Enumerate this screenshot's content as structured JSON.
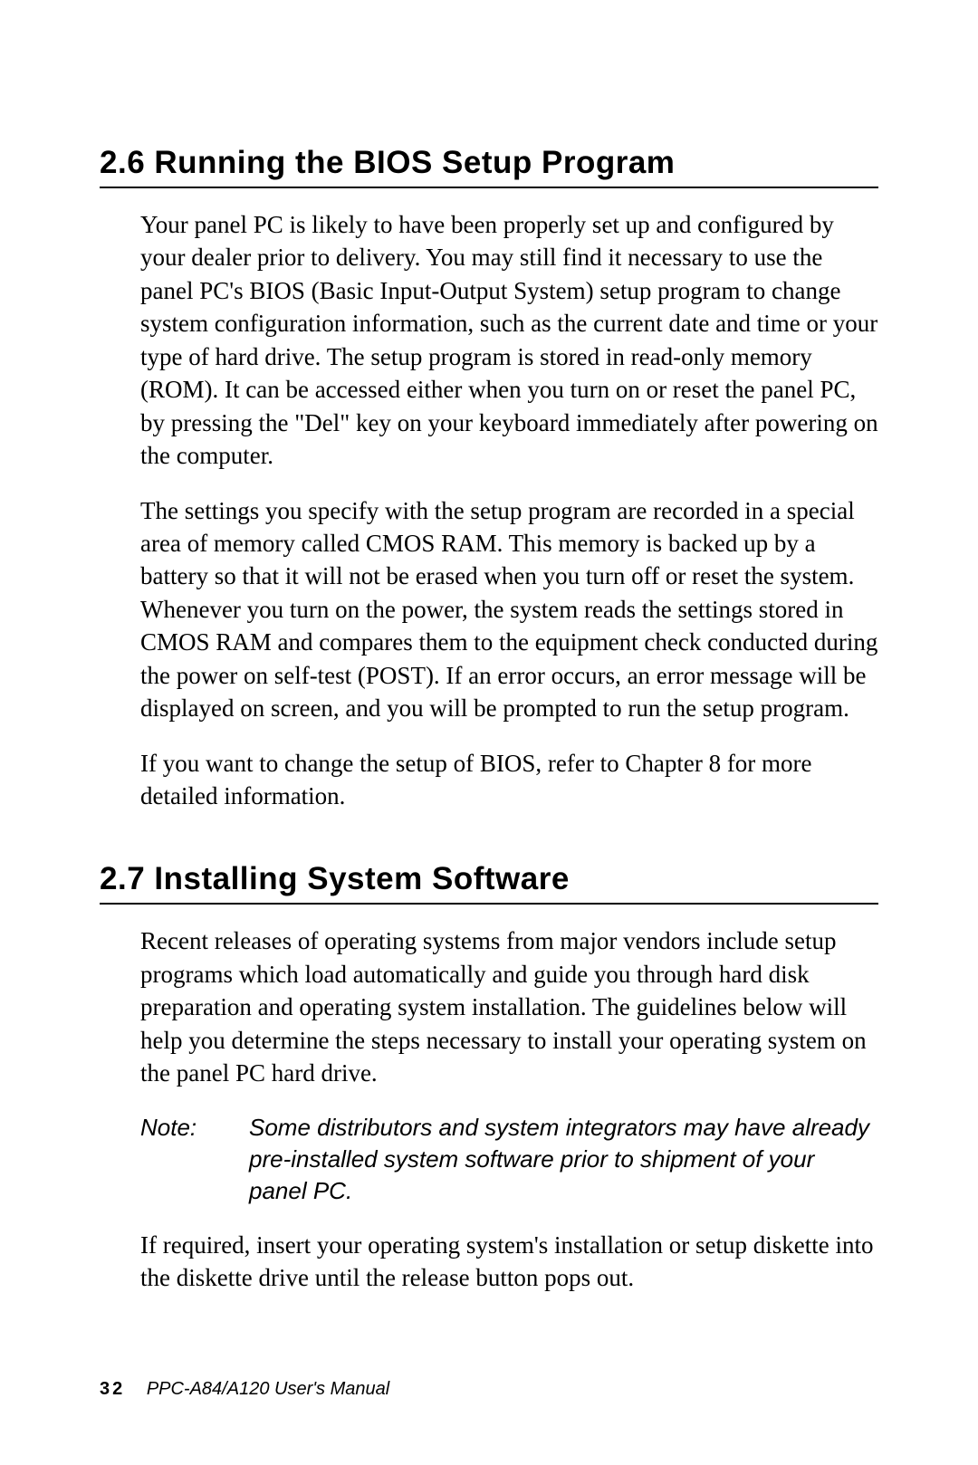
{
  "sections": [
    {
      "number": "2.6",
      "title": "Running the BIOS Setup Program",
      "paragraphs": [
        "Your panel PC is likely to have been properly set up and configured by your dealer prior to delivery. You may still find it necessary to use the panel PC's BIOS (Basic Input-Output System) setup program to change system configuration information, such as the current date and time or your type of hard drive. The setup program is stored in read-only memory (ROM). It can be accessed either when you turn on or reset the panel PC, by pressing the \"Del\" key on your keyboard immediately after powering on the computer.",
        "The settings you specify with the setup program are recorded in a special area of memory called CMOS RAM. This memory is backed up by a battery so that it will not be erased when you turn off or reset the system. Whenever you turn on the power, the system reads the settings stored in CMOS RAM and compares them to the equipment check conducted during the power on self-test (POST). If an error occurs, an error message will be displayed on screen, and you will be prompted to run the setup program.",
        "If you want to change the setup of BIOS, refer to Chapter 8 for more detailed information."
      ]
    },
    {
      "number": "2.7",
      "title": "Installing System Software",
      "paragraphs": [
        "Recent releases of operating systems from major vendors include setup programs which load automatically and guide you through hard disk preparation and operating system installation. The guidelines below will help you determine the steps necessary to install your operating system on the panel PC hard drive."
      ],
      "note": {
        "label": "Note:",
        "text": "Some distributors and system integrators may have already pre-installed system software prior to ship­ment of your panel PC."
      },
      "postNoteParagraphs": [
        "If required, insert your operating system's installation or setup diskette into the diskette drive until the release button pops out."
      ]
    }
  ],
  "footer": {
    "pageNumber": "32",
    "docTitle": "PPC-A84/A120 User's Manual"
  }
}
